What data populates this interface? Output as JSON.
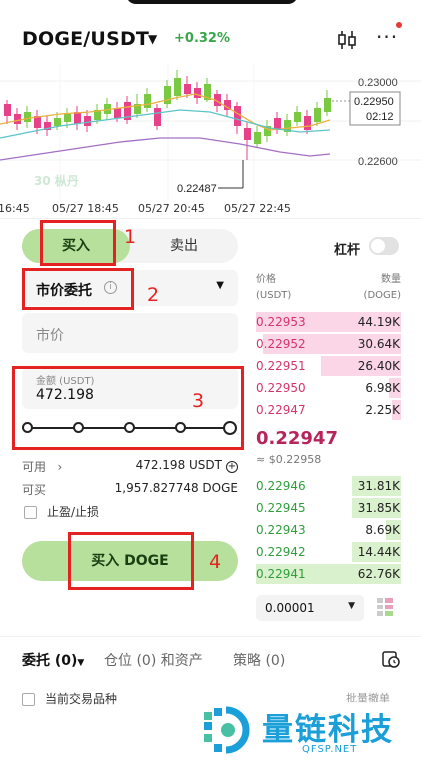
{
  "header": {
    "pair": "DOGE/USDT",
    "change": "+0.32%",
    "icons": [
      "kline-icon",
      "more-icon"
    ],
    "change_color": "#3aa64a"
  },
  "chart": {
    "price_labels": [
      "0.23000",
      "0.22950",
      "02:12",
      "0.22600"
    ],
    "low_marker": "0.22487",
    "time_labels": [
      "16:45",
      "05/27 18:45",
      "05/27 20:45",
      "05/27 22:45"
    ],
    "watermark": "30 枞丹"
  },
  "trade": {
    "tab_buy": "买入",
    "tab_sell": "卖出",
    "leverage_label": "杠杆",
    "order_type": "市价委托",
    "price_placeholder": "市价",
    "amount_label": "金额 (USDT)",
    "amount_value": "472.198",
    "available_label": "可用",
    "available_value": "472.198 USDT",
    "can_buy_label": "可买",
    "can_buy_value": "1,957.827748 DOGE",
    "tpsl_label": "止盈/止损",
    "buy_button": "买入 DOGE",
    "slider_percent": 100,
    "buy_color": "#b6e09b"
  },
  "orderbook": {
    "price_header": "价格",
    "price_unit": "(USDT)",
    "qty_header": "数量",
    "qty_unit": "(DOGE)",
    "asks": [
      {
        "price": "0.22953",
        "qty": "44.19K",
        "depth": 1.0
      },
      {
        "price": "0.22952",
        "qty": "30.64K",
        "depth": 0.95
      },
      {
        "price": "0.22951",
        "qty": "26.40K",
        "depth": 0.55
      },
      {
        "price": "0.22950",
        "qty": "6.98K",
        "depth": 0.08
      },
      {
        "price": "0.22947",
        "qty": "2.25K",
        "depth": 0.06
      }
    ],
    "last_price": "0.22947",
    "last_price_usd": "≈ $0.22958",
    "bids": [
      {
        "price": "0.22946",
        "qty": "31.81K",
        "depth": 0.34
      },
      {
        "price": "0.22945",
        "qty": "31.85K",
        "depth": 0.34
      },
      {
        "price": "0.22943",
        "qty": "8.69K",
        "depth": 0.1
      },
      {
        "price": "0.22942",
        "qty": "14.44K",
        "depth": 0.34
      },
      {
        "price": "0.22941",
        "qty": "62.76K",
        "depth": 1.0
      }
    ],
    "precision": "0.00001",
    "ask_color": "#d6336c",
    "bid_color": "#2e9e3b"
  },
  "bottom": {
    "tab_orders": "委托 (0)",
    "tab_positions": "仓位 (0) 和资产",
    "tab_strategy": "策略 (0)",
    "current_pair": "当前交易品种",
    "batch_cancel": "批量撤单"
  },
  "annotations": [
    "1",
    "2",
    "3",
    "4"
  ],
  "logo": {
    "name": "量链科技",
    "site": "QFSP.NET",
    "color": "#1a9fd8"
  }
}
